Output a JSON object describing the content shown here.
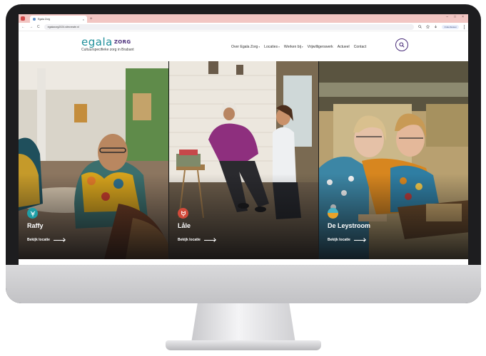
{
  "browser": {
    "tab_title": "Egala Zorg",
    "tab_close": "×",
    "new_tab": "+",
    "url": "egalazorg2024.sitecreate.nl",
    "back": "←",
    "forward": "→",
    "reload": "C",
    "profile_label": "Onderbreken",
    "window_minimize": "–",
    "window_maximize": "□",
    "window_close": "×"
  },
  "site": {
    "logo_brand": "egala",
    "logo_brand_suffix": "ZORG",
    "logo_tagline": "Cultuurspecifieke zorg in Brabant",
    "nav": [
      {
        "label": "Over Egala Zorg",
        "caret": "▾"
      },
      {
        "label": "Locaties",
        "caret": "▾"
      },
      {
        "label": "Werken bij",
        "caret": "▾"
      },
      {
        "label": "Vrijwilligerswerk",
        "caret": ""
      },
      {
        "label": "Actueel",
        "caret": ""
      },
      {
        "label": "Contact",
        "caret": ""
      }
    ],
    "search_icon": "search-icon"
  },
  "cards": [
    {
      "title": "Raffy",
      "link": "Bekijk locatie",
      "badge_color": "#1f9ea5",
      "icon": "tree-icon"
    },
    {
      "title": "Låle",
      "link": "Bekijk locatie",
      "badge_color": "#d24a3a",
      "icon": "tulip-icon"
    },
    {
      "title": "De Leystroom",
      "link": "Bekijk locatie",
      "badge_color": "#1f8fb0",
      "icon": "water-icon"
    }
  ],
  "colors": {
    "brand_teal": "#1f8f9a",
    "brand_purple": "#4a2d7a",
    "tab_bar": "#f2c6c3"
  }
}
